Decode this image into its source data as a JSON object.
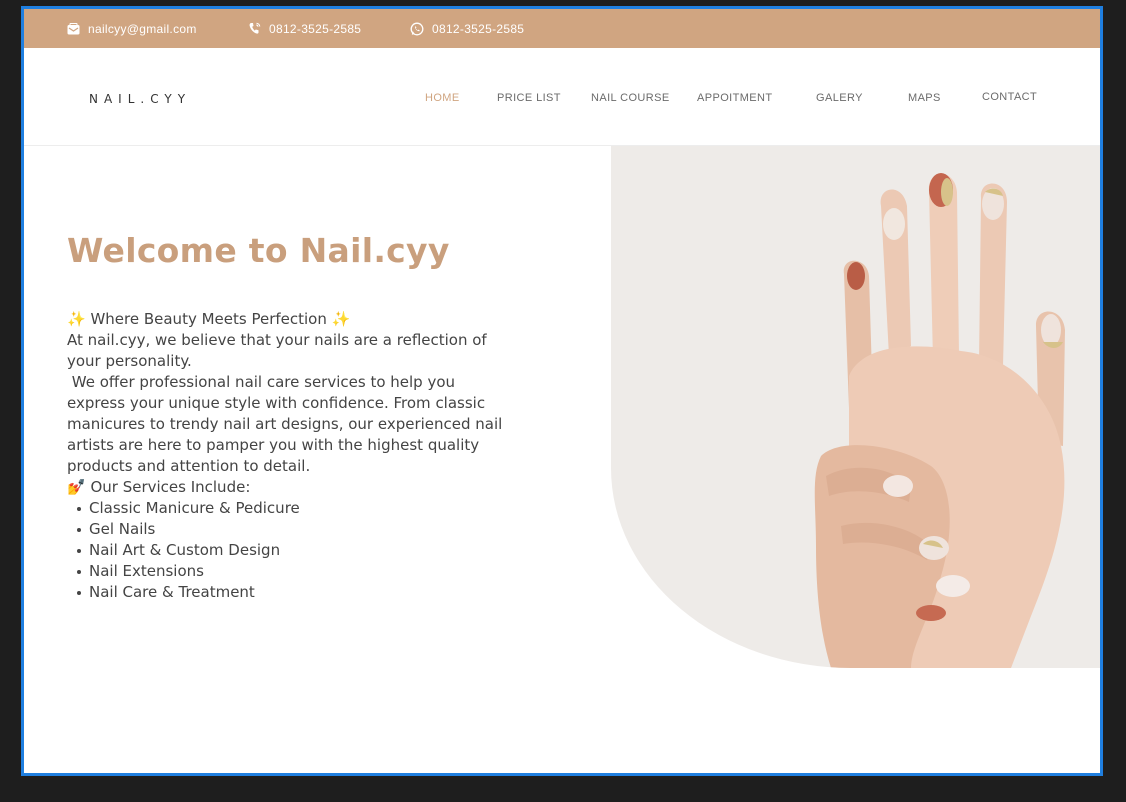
{
  "topbar": {
    "email": "nailcyy@gmail.com",
    "phone": "0812-3525-2585",
    "whatsapp": "0812-3525-2585",
    "icons": [
      "mail-icon",
      "phone-icon",
      "whatsapp-icon"
    ]
  },
  "brand": {
    "logo": "NAIL.CYY"
  },
  "nav": {
    "items": [
      {
        "label": "HOME",
        "active": true
      },
      {
        "label": "PRICE LIST"
      },
      {
        "label": "NAIL COURSE"
      },
      {
        "label": "APPOITMENT"
      },
      {
        "label": "GALERY"
      },
      {
        "label": "MAPS"
      },
      {
        "label": "CONTACT"
      }
    ]
  },
  "hero": {
    "title": "Welcome to Nail.cyy",
    "tagline": "✨ Where Beauty Meets Perfection ✨",
    "intro": "At nail.cyy, we believe that your nails are a reflection of your personality.",
    "body": " We offer professional nail care services to help you express your unique style with confidence. From classic manicures to trendy nail art designs, our experienced nail artists are here to pamper you with the highest quality products and attention to detail.",
    "services_heading": "💅 Our Services Include:",
    "services": [
      "Classic Manicure & Pedicure",
      "Gel Nails",
      "Nail Art & Custom Design",
      "Nail Extensions",
      "Nail Care & Treatment"
    ]
  },
  "colors": {
    "accent": "#d0a581",
    "title": "#c99f7d",
    "frame_border": "#1f7fe0",
    "image_bg": "#eeebe8"
  }
}
